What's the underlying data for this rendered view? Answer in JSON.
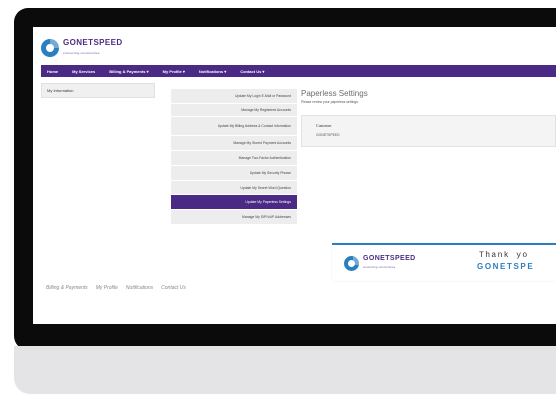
{
  "brand": {
    "name": "GONETSPEED",
    "tagline": "connecting communities",
    "logo_color": "#2a7fc1",
    "text_color": "#4d2c83"
  },
  "nav": {
    "color": "#4b2a85",
    "items": [
      "Home",
      "My Services",
      "Billing & Payments ▾",
      "My Profile ▾",
      "Notifications ▾",
      "Contact Us ▾"
    ]
  },
  "sidebar": {
    "label": "My Information"
  },
  "menu": {
    "items": [
      "Update My Login E-Mail or Password",
      "Manage My Registered Accounts",
      "Update My Billing Address & Contact Information",
      "Manage My Stored Payment Accounts",
      "Manage Two-Factor Authentication",
      "Update My Security Phrase",
      "Update My Secret Word Question",
      "Update My Paperless Settings",
      "Manage My SIP/VoIP Addresses"
    ],
    "active_index": 7
  },
  "content": {
    "title": "Paperless Settings",
    "subtitle": "Please review your paperless settings.",
    "customer_label": "Customer",
    "customer_value": "GONETSPEED"
  },
  "banner": {
    "thanks": "Thank yo",
    "brand": "GONETSPE"
  },
  "footer": {
    "links": [
      "Billing & Payments",
      "My Profile",
      "Notifications",
      "Contact Us"
    ]
  }
}
